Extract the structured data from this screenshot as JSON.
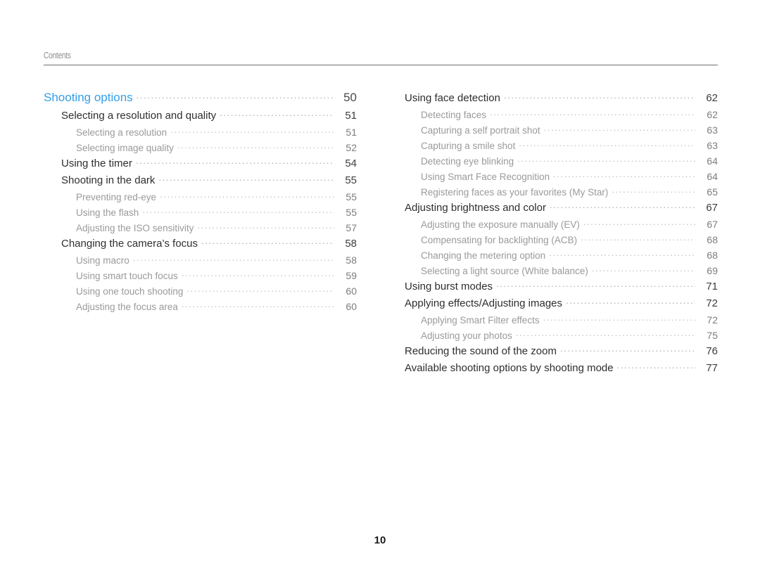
{
  "header": {
    "running_label": "Contents"
  },
  "folio": {
    "page_number": "10"
  },
  "colors": {
    "part_heading": "#33a0e8",
    "chapter_heading": "#2e2e2e",
    "sub_entry": "#9a9a9a",
    "rule": "#6e6e6e",
    "leader_dots": "#a8a8a8",
    "background": "#ffffff"
  },
  "toc": {
    "left_column": [
      {
        "level": 1,
        "title": "Shooting options",
        "page": "50"
      },
      {
        "level": 2,
        "title": "Selecting a resolution and quality",
        "page": "51"
      },
      {
        "level": 3,
        "title": "Selecting a resolution",
        "page": "51"
      },
      {
        "level": 3,
        "title": "Selecting image quality",
        "page": "52"
      },
      {
        "level": 2,
        "title": "Using the timer",
        "page": "54"
      },
      {
        "level": 2,
        "title": "Shooting in the dark",
        "page": "55"
      },
      {
        "level": 3,
        "title": "Preventing red-eye",
        "page": "55"
      },
      {
        "level": 3,
        "title": "Using the flash",
        "page": "55"
      },
      {
        "level": 3,
        "title": "Adjusting the ISO sensitivity",
        "page": "57"
      },
      {
        "level": 2,
        "title": "Changing the camera’s focus",
        "page": "58"
      },
      {
        "level": 3,
        "title": "Using macro",
        "page": "58"
      },
      {
        "level": 3,
        "title": "Using smart touch focus",
        "page": "59"
      },
      {
        "level": 3,
        "title": "Using one touch shooting",
        "page": "60"
      },
      {
        "level": 3,
        "title": "Adjusting the focus area",
        "page": "60"
      }
    ],
    "right_column": [
      {
        "level": 2,
        "title": "Using face detection",
        "page": "62"
      },
      {
        "level": 3,
        "title": "Detecting faces",
        "page": "62"
      },
      {
        "level": 3,
        "title": "Capturing a self portrait shot",
        "page": "63"
      },
      {
        "level": 3,
        "title": "Capturing a smile shot",
        "page": "63"
      },
      {
        "level": 3,
        "title": "Detecting eye blinking",
        "page": "64"
      },
      {
        "level": 3,
        "title": "Using Smart Face Recognition",
        "page": "64"
      },
      {
        "level": 3,
        "title": "Registering faces as your favorites (My Star)",
        "page": "65"
      },
      {
        "level": 2,
        "title": "Adjusting brightness and color",
        "page": "67"
      },
      {
        "level": 3,
        "title": "Adjusting the exposure manually (EV)",
        "page": "67"
      },
      {
        "level": 3,
        "title": "Compensating for backlighting (ACB)",
        "page": "68"
      },
      {
        "level": 3,
        "title": "Changing the metering option",
        "page": "68"
      },
      {
        "level": 3,
        "title": "Selecting a light source (White balance)",
        "page": "69"
      },
      {
        "level": 2,
        "title": "Using burst modes",
        "page": "71"
      },
      {
        "level": 2,
        "title": "Applying effects/Adjusting images",
        "page": "72"
      },
      {
        "level": 3,
        "title": "Applying Smart Filter effects",
        "page": "72"
      },
      {
        "level": 3,
        "title": "Adjusting your photos",
        "page": "75"
      },
      {
        "level": 2,
        "title": "Reducing the sound of the zoom",
        "page": "76"
      },
      {
        "level": 2,
        "title": "Available shooting options by shooting mode",
        "page": "77"
      }
    ]
  }
}
